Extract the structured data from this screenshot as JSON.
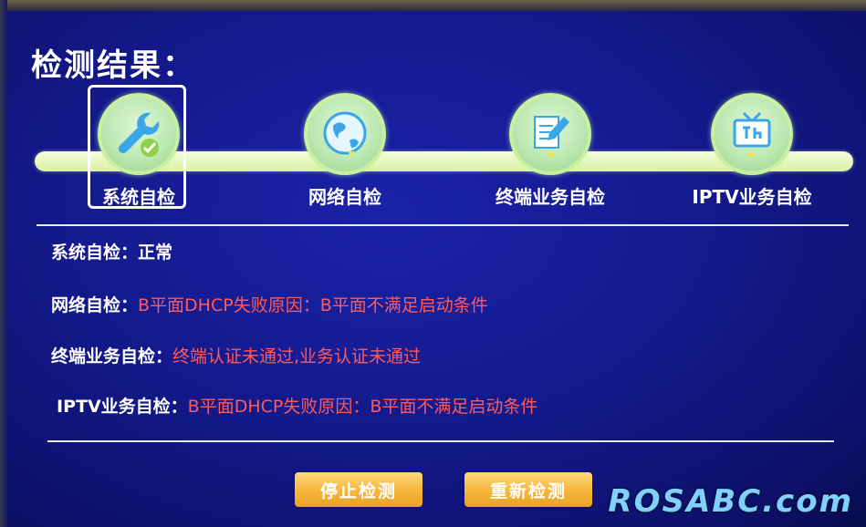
{
  "title": "检测结果：",
  "steps": [
    {
      "label": "系统自检",
      "icon": "wrench-check-icon",
      "selected": true
    },
    {
      "label": "网络自检",
      "icon": "globe-icon",
      "selected": false
    },
    {
      "label": "终端业务自检",
      "icon": "document-pen-icon",
      "selected": false
    },
    {
      "label": "IPTV业务自检",
      "icon": "tv-icon",
      "selected": false
    }
  ],
  "results": [
    {
      "key": "系统自检：",
      "value": "正常",
      "status": "ok"
    },
    {
      "key": "网络自检：",
      "value": "B平面DHCP失败原因：B平面不满足启动条件",
      "status": "error"
    },
    {
      "key": "终端业务自检：",
      "value": "终端认证未通过,业务认证未通过",
      "status": "error"
    },
    {
      "key": "IPTV业务自检：",
      "value": "B平面DHCP失败原因：B平面不满足启动条件",
      "status": "error"
    }
  ],
  "buttons": {
    "stop": "停止检测",
    "retest": "重新检测"
  },
  "watermark": "ROSABC.com",
  "colors": {
    "background": "#141a8e",
    "error_text": "#ff5a5a",
    "button": "#f6b63b",
    "step_circle": "#bde8b2"
  }
}
